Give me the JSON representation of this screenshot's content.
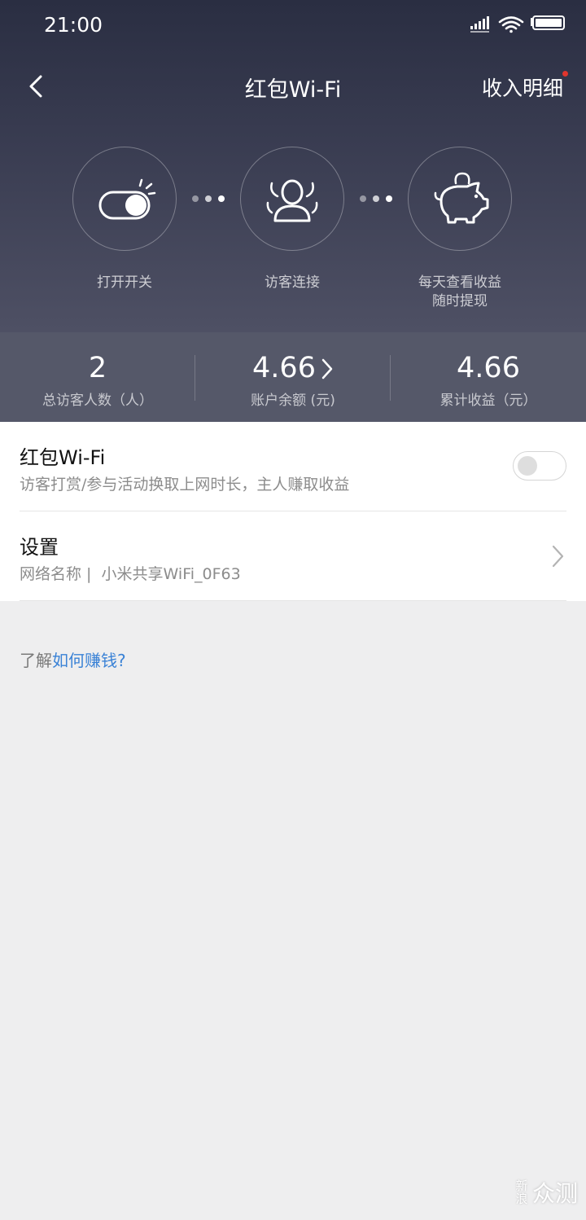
{
  "status_bar": {
    "time": "21:00"
  },
  "nav": {
    "title": "红包Wi-Fi",
    "right_label": "收入明细"
  },
  "steps": [
    {
      "label": "打开开关",
      "icon": "toggle-switch-icon"
    },
    {
      "label": "访客连接",
      "icon": "visitor-person-icon"
    },
    {
      "label": "每天查看收益",
      "label2": "随时提现",
      "icon": "piggy-bank-icon"
    }
  ],
  "stats": [
    {
      "value": "2",
      "label": "总访客人数（人）"
    },
    {
      "value": "4.66",
      "label": "账户余额 (元)"
    },
    {
      "value": "4.66",
      "label": "累计收益（元）"
    }
  ],
  "wifi_row": {
    "title": "红包Wi-Fi",
    "subtitle": "访客打赏/参与活动换取上网时长，主人赚取收益",
    "toggle_on": false
  },
  "settings_row": {
    "title": "设置",
    "network_prefix": "网络名称 |",
    "network_name": "小米共享WiFi_0F63"
  },
  "help": {
    "prefix": "了解",
    "link": "如何赚钱?"
  },
  "watermark": {
    "small_top": "新",
    "small_bottom": "浪",
    "big": "众测"
  },
  "colors": {
    "accent_link": "#3a82d6",
    "red_dot": "#e0352d",
    "header_top": "#2a2e42",
    "stats_bg": "#555869"
  }
}
